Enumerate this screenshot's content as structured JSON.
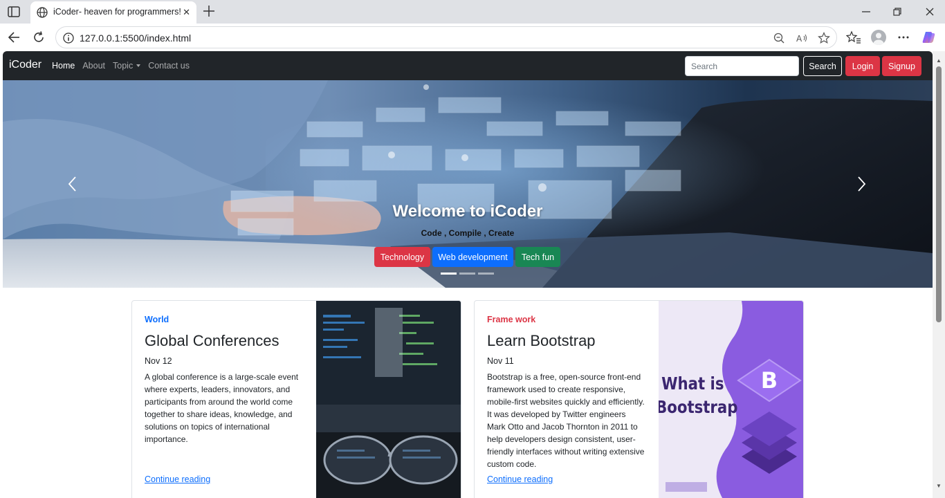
{
  "browser": {
    "tab_title": "iCoder- heaven for programmers!",
    "url": "127.0.0.1:5500/index.html"
  },
  "navbar": {
    "brand": "iCoder",
    "links": [
      "Home",
      "About",
      "Topic",
      "Contact us"
    ],
    "active_link": "Home",
    "search_placeholder": "Search",
    "search_button": "Search",
    "login_button": "Login",
    "signup_button": "Signup"
  },
  "carousel": {
    "title": "Welcome to iCoder",
    "subtitle": "Code , Compile , Create",
    "buttons": [
      {
        "label": "Technology",
        "color": "#dc3545"
      },
      {
        "label": "Web development",
        "color": "#0d6efd"
      },
      {
        "label": "Tech fun",
        "color": "#198754"
      }
    ],
    "slides_count": 3,
    "active_slide": 1
  },
  "cards": [
    {
      "category": "World",
      "category_color": "#0d6efd",
      "title": "Global Conferences",
      "date": "Nov 12",
      "text": "A global conference is a large-scale event where experts, leaders, innovators, and participants from around the world come together to share ideas, knowledge, and solutions on topics of international importance.",
      "link": "Continue reading"
    },
    {
      "category": "Frame work",
      "category_color": "#dc3545",
      "title": "Learn Bootstrap",
      "date": "Nov 11",
      "text": "Bootstrap is a free, open-source front-end framework used to create responsive, mobile-first websites quickly and efficiently. It was developed by Twitter engineers Mark Otto and Jacob Thornton in 2011 to help developers design consistent, user-friendly interfaces without writing extensive custom code.",
      "link": "Continue reading",
      "image_text": [
        "What is",
        "Bootstrap"
      ]
    }
  ]
}
